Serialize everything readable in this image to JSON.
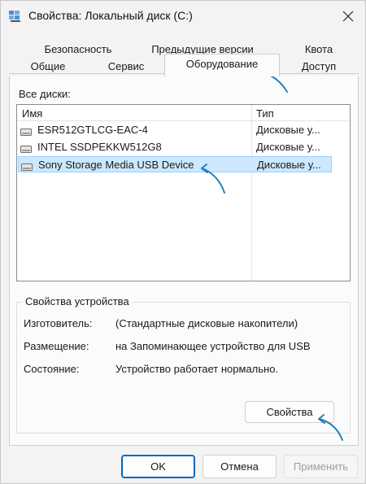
{
  "window": {
    "title": "Свойства: Локальный диск (C:)"
  },
  "tabs": {
    "row1": [
      "Безопасность",
      "Предыдущие версии",
      "Квота"
    ],
    "row2": [
      "Общие",
      "Сервис",
      "Оборудование",
      "Доступ"
    ],
    "active": "Оборудование"
  },
  "disks": {
    "label": "Все диски:",
    "columns": {
      "name": "Имя",
      "type": "Тип"
    },
    "rows": [
      {
        "name": "ESR512GTLCG-EAC-4",
        "type": "Дисковые у...",
        "selected": false
      },
      {
        "name": "INTEL SSDPEKKW512G8",
        "type": "Дисковые у...",
        "selected": false
      },
      {
        "name": "Sony Storage Media USB Device",
        "type": "Дисковые у...",
        "selected": true
      }
    ]
  },
  "device_properties": {
    "title": "Свойства устройства",
    "manufacturer_label": "Изготовитель:",
    "manufacturer_value": "(Стандартные дисковые накопители)",
    "location_label": "Размещение:",
    "location_value": "на Запоминающее устройство для USB",
    "status_label": "Состояние:",
    "status_value": "Устройство работает нормально.",
    "properties_button": "Свойства"
  },
  "footer": {
    "ok": "OK",
    "cancel": "Отмена",
    "apply": "Применить"
  },
  "colors": {
    "accent": "#0067c0",
    "selection": "#cce8ff",
    "arrow": "#2b7fb8"
  }
}
